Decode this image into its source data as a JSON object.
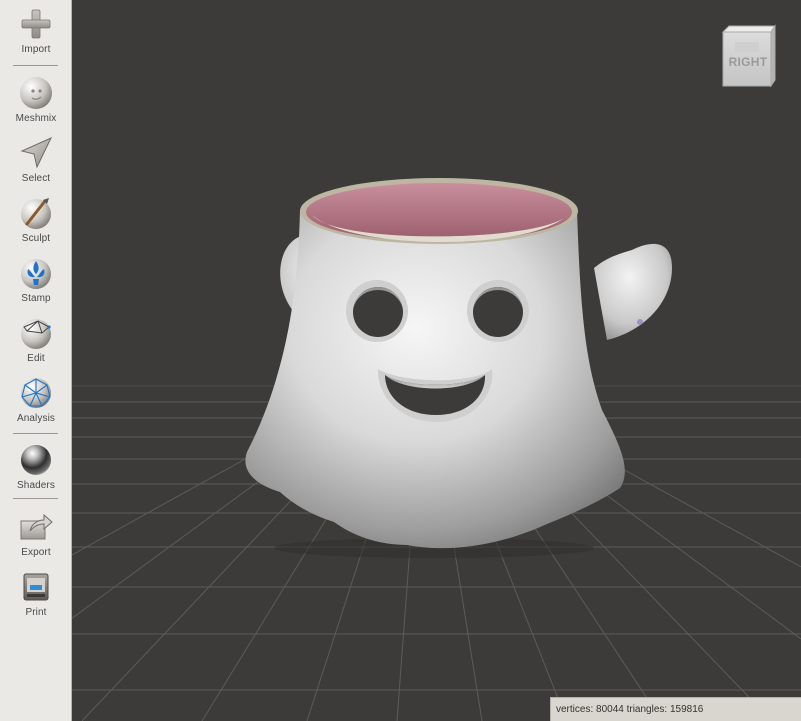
{
  "sidebar": {
    "tools": [
      {
        "id": "import",
        "label": "Import",
        "icon": "plus-icon"
      },
      {
        "id": "meshmix",
        "label": "Meshmix",
        "icon": "face-sphere-icon"
      },
      {
        "id": "select",
        "label": "Select",
        "icon": "arrow-cursor-icon"
      },
      {
        "id": "sculpt",
        "label": "Sculpt",
        "icon": "brush-sphere-icon"
      },
      {
        "id": "stamp",
        "label": "Stamp",
        "icon": "fleur-sphere-icon"
      },
      {
        "id": "edit",
        "label": "Edit",
        "icon": "wireframe-sphere-icon"
      },
      {
        "id": "analysis",
        "label": "Analysis",
        "icon": "mesh-sphere-icon"
      },
      {
        "id": "shaders",
        "label": "Shaders",
        "icon": "chrome-sphere-icon"
      },
      {
        "id": "export",
        "label": "Export",
        "icon": "export-arrow-icon"
      },
      {
        "id": "print",
        "label": "Print",
        "icon": "printer-icon"
      }
    ]
  },
  "viewport": {
    "view_cube_label": "RIGHT",
    "background": "#3c3b3a",
    "grid_color": "#5a5957",
    "model_color": "#d8d8d8",
    "model_interior_color": "#a86b7a"
  },
  "status": {
    "stats": "vertices: 80044 triangles: 159816"
  }
}
